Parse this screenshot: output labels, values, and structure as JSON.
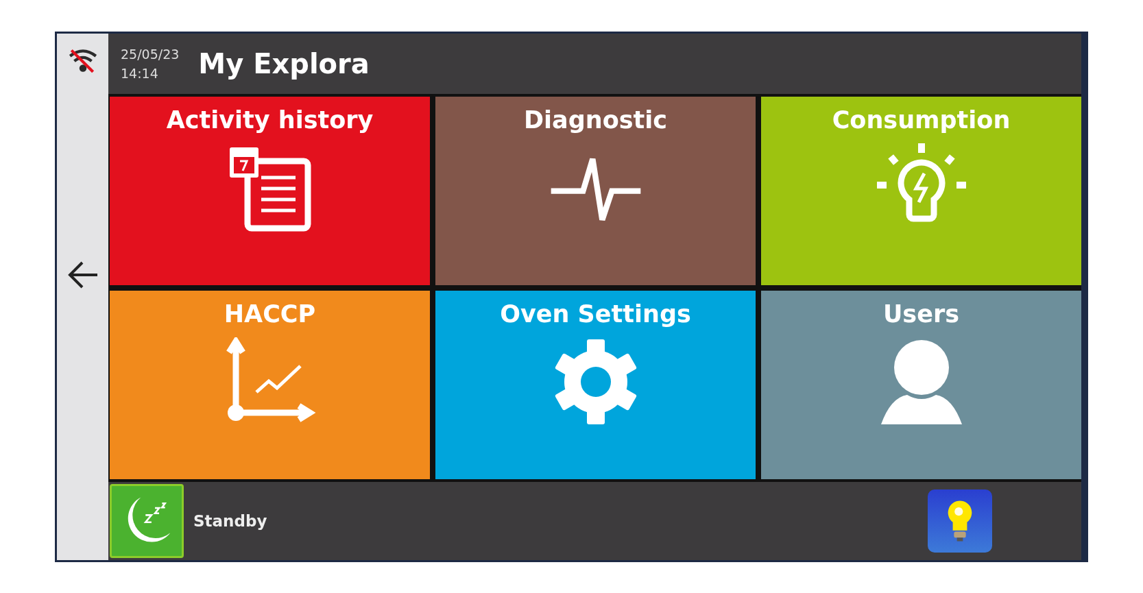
{
  "header": {
    "date": "25/05/23",
    "time": "14:14",
    "title": "My Explora"
  },
  "tiles": [
    {
      "label": "Activity history",
      "kind": "history",
      "color": "#e3111e"
    },
    {
      "label": "Diagnostic",
      "kind": "diagnostic",
      "color": "#82564a"
    },
    {
      "label": "Consumption",
      "kind": "consumption",
      "color": "#9dc310"
    },
    {
      "label": "HACCP",
      "kind": "haccp",
      "color": "#f18a1c"
    },
    {
      "label": "Oven Settings",
      "kind": "settings",
      "color": "#00a5dc"
    },
    {
      "label": "Users",
      "kind": "users",
      "color": "#6d8f9b"
    }
  ],
  "footer": {
    "standby_label": "Standby"
  }
}
